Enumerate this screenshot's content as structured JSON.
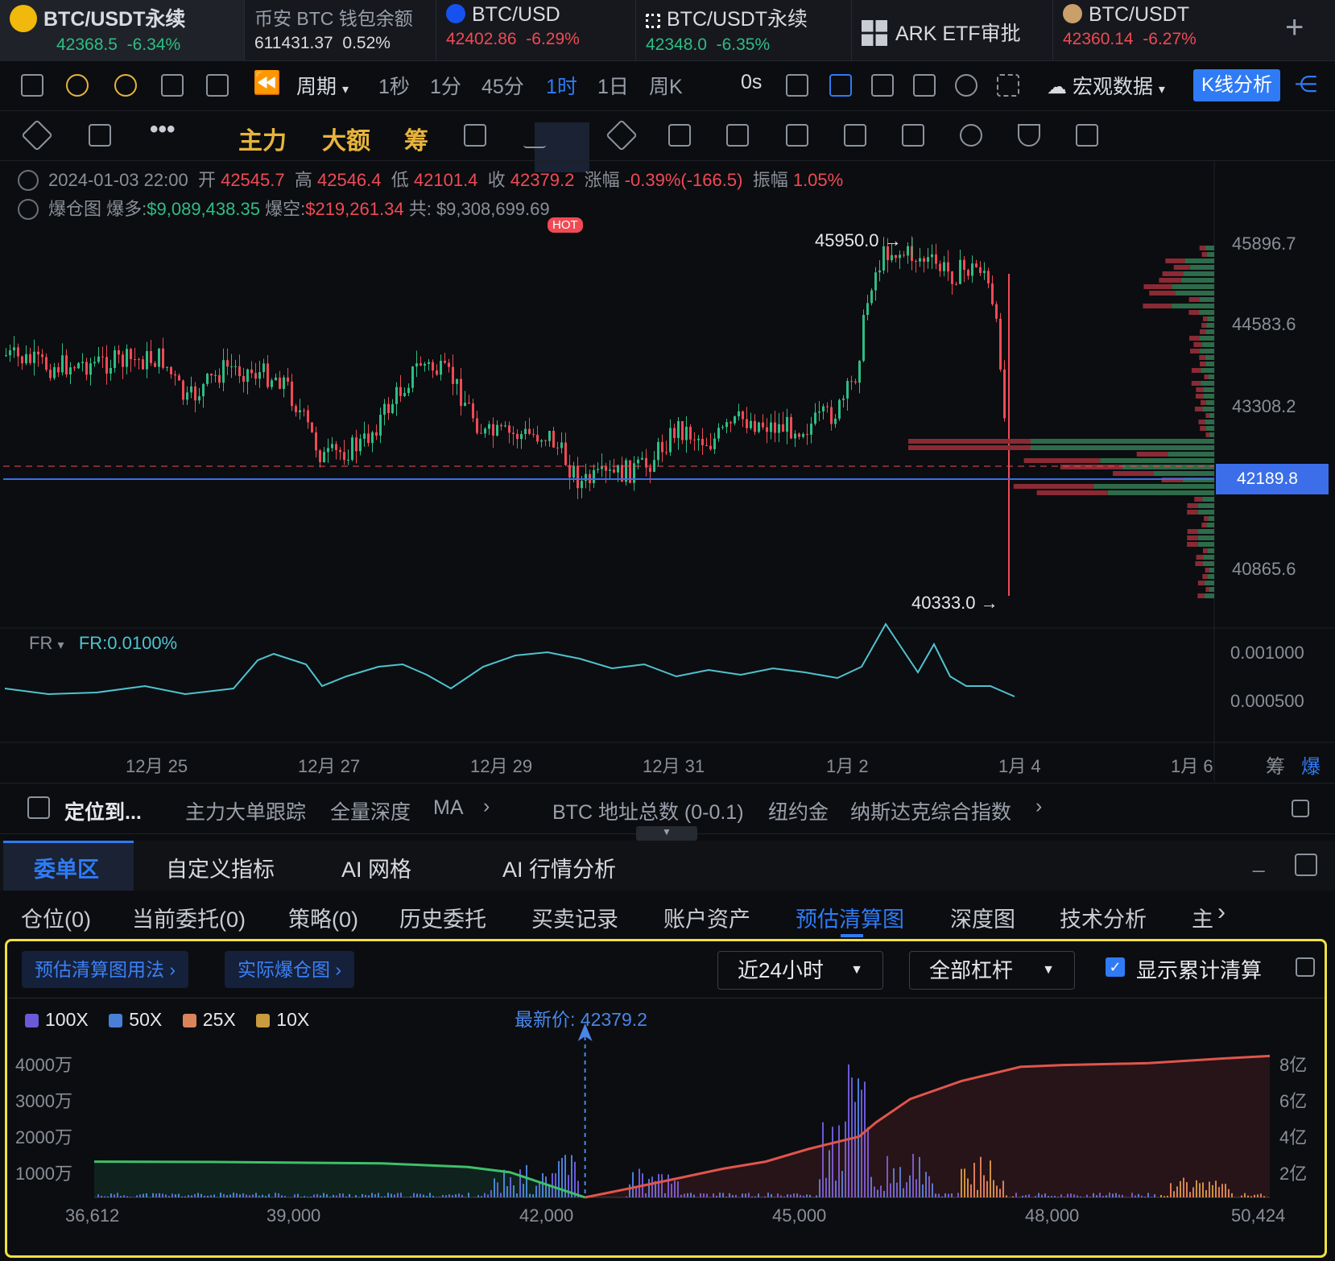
{
  "tickers": [
    {
      "name": "BTC/USDT永续",
      "price": "42368.5",
      "change": "-6.34%",
      "color": "#2ebd85",
      "change_color": "#2ebd85",
      "icon": "binance-icon"
    },
    {
      "name": "币安 BTC 钱包余额",
      "price": "611431.37",
      "change": "0.52%",
      "color": "#d8dbe0",
      "change_color": "#d8dbe0",
      "icon": ""
    },
    {
      "name": "BTC/USD",
      "price": "42402.86",
      "change": "-6.29%",
      "color": "#f04a55",
      "change_color": "#f04a55",
      "icon": "coinbase-icon"
    },
    {
      "name": "BTC/USDT永续",
      "price": "42348.0",
      "change": "-6.35%",
      "color": "#2ebd85",
      "change_color": "#2ebd85",
      "icon": "okx-icon"
    },
    {
      "name": "ARK ETF审批",
      "price": "",
      "change": "",
      "color": "#d8dbe0",
      "change_color": "#d8dbe0",
      "icon": "grid-icon"
    },
    {
      "name": "BTC/USDT",
      "price": "42360.14",
      "change": "-6.27%",
      "color": "#f04a55",
      "change_color": "#f04a55",
      "icon": "coin-icon"
    }
  ],
  "toolbar": {
    "period_label": "周期",
    "intervals": [
      "1秒",
      "1分",
      "45分",
      "1时",
      "1日",
      "周K"
    ],
    "active_interval": "1时",
    "countdown": "0s",
    "macro_label": "宏观数据",
    "kline_analysis": "K线分析"
  },
  "toolbar2": {
    "zhuli": "主力",
    "dae": "大额",
    "chou": "筹",
    "hot": "HOT"
  },
  "ohlc": {
    "date": "2024-01-03 22:00",
    "open_label": "开",
    "open": "42545.7",
    "high_label": "高",
    "high": "42546.4",
    "low_label": "低",
    "low": "42101.4",
    "close_label": "收",
    "close": "42379.2",
    "change_label": "涨幅",
    "change": "-0.39%(-166.5)",
    "amp_label": "振幅",
    "amp": "1.05%"
  },
  "liq_row": {
    "label": "爆仓图",
    "long_label": "爆多:",
    "long": "$9,089,438.35",
    "short_label": "爆空:",
    "short": "$219,261.34",
    "total_label": "共:",
    "total": "$9,308,699.69"
  },
  "price_axis": [
    "45896.7",
    "44583.6",
    "43308.2",
    "40865.6"
  ],
  "current_price": "42189.8",
  "high_marker": "45950.0 →",
  "low_marker": "40333.0 →",
  "fr": {
    "label": "FR",
    "value": "FR:0.0100%",
    "axis": [
      "0.001000",
      "0.000500"
    ]
  },
  "date_axis": [
    "12月 25",
    "12月 27",
    "12月 29",
    "12月 31",
    "1月 2",
    "1月 4",
    "1月 6"
  ],
  "date_axis_right": {
    "chou": "筹",
    "bao": "爆"
  },
  "bottom_nav": {
    "locate": "定位到...",
    "items": [
      "主力大单跟踪",
      "全量深度",
      "MA"
    ],
    "items2": [
      "BTC 地址总数 (0-0.1)",
      "纽约金",
      "纳斯达克综合指数"
    ]
  },
  "panel_tabs": [
    "委单区",
    "自定义指标",
    "AI 网格",
    "AI 行情分析"
  ],
  "sub_tabs": [
    "仓位(0)",
    "当前委托(0)",
    "策略(0)",
    "历史委托",
    "买卖记录",
    "账户资产",
    "预估清算图",
    "深度图",
    "技术分析",
    "主"
  ],
  "active_sub_tab": "预估清算图",
  "liq_map": {
    "guide_btn": "预估清算图用法",
    "actual_btn": "实际爆仓图",
    "range_select": "近24小时",
    "leverage_select": "全部杠杆",
    "show_cumulative": "显示累计清算",
    "legend": [
      {
        "label": "100X",
        "color": "#6a5ad8"
      },
      {
        "label": "50X",
        "color": "#4a7fd8"
      },
      {
        "label": "25X",
        "color": "#d9845a"
      },
      {
        "label": "10X",
        "color": "#c99a3e"
      }
    ],
    "latest_price": "最新价: 42379.2",
    "y_left": [
      "4000万",
      "3000万",
      "2000万",
      "1000万"
    ],
    "y_right": [
      "8亿",
      "6亿",
      "4亿",
      "2亿"
    ],
    "x_axis": [
      "36,612",
      "39,000",
      "42,000",
      "45,000",
      "48,000",
      "50,424"
    ]
  },
  "chart_data": {
    "type": "area",
    "x": [
      36612,
      38000,
      39000,
      40000,
      41000,
      41500,
      42000,
      42379.2,
      42900,
      43500,
      44000,
      44500,
      45000,
      45600,
      45800,
      46200,
      46800,
      47500,
      48000,
      49000,
      50000,
      50424
    ],
    "series": [
      {
        "values": [
          1000,
          990,
          970,
          950,
          850,
          700,
          300,
          0,
          null,
          null,
          null,
          null,
          null,
          null,
          null,
          null,
          null,
          null,
          null,
          null,
          null,
          null
        ]
      },
      {
        "values": [
          null,
          null,
          null,
          null,
          null,
          null,
          null,
          0,
          5000,
          11000,
          16000,
          20000,
          27000,
          34000,
          42000,
          55000,
          65000,
          73000,
          74000,
          75000,
          78000,
          79000
        ]
      }
    ],
    "ylim_left": [
      0,
      4500
    ],
    "ylim_right": [
      0,
      90000
    ],
    "xlim": [
      36612,
      50424
    ]
  }
}
